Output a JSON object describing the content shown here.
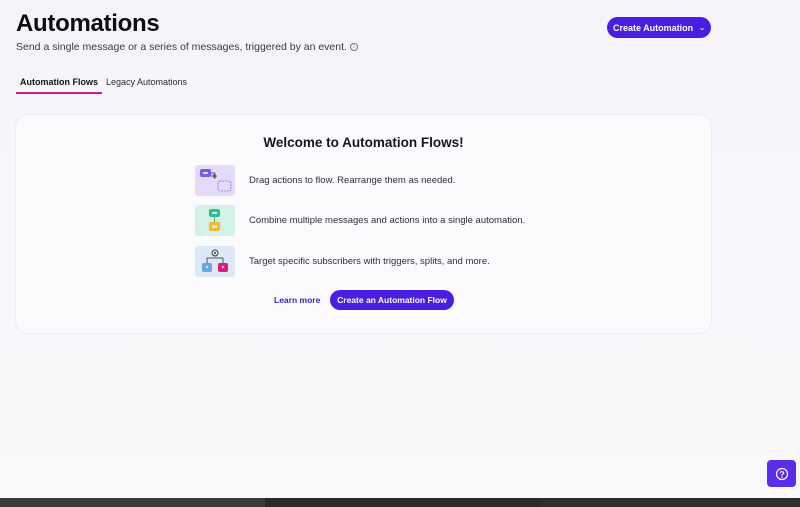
{
  "header": {
    "title": "Automations",
    "subtitle": "Send a single message or a series of messages, triggered by an event.",
    "create_button": "Create Automation"
  },
  "tabs": [
    {
      "label": "Automation Flows",
      "active": true
    },
    {
      "label": "Legacy Automations",
      "active": false
    }
  ],
  "welcome": {
    "title": "Welcome to Automation Flows!",
    "features": [
      {
        "icon": "drag-flow-icon",
        "text": "Drag actions to flow. Rearrange them as needed."
      },
      {
        "icon": "combine-messages-icon",
        "text": "Combine multiple messages and actions into a single automation."
      },
      {
        "icon": "target-subscribers-icon",
        "text": "Target specific subscribers with triggers, splits, and more."
      }
    ],
    "learn_more": "Learn more",
    "create_flow_button": "Create an Automation Flow"
  },
  "colors": {
    "accent": "#4a1ee0",
    "tab_underline": "#c01f8c",
    "link": "#3b1dbd"
  }
}
